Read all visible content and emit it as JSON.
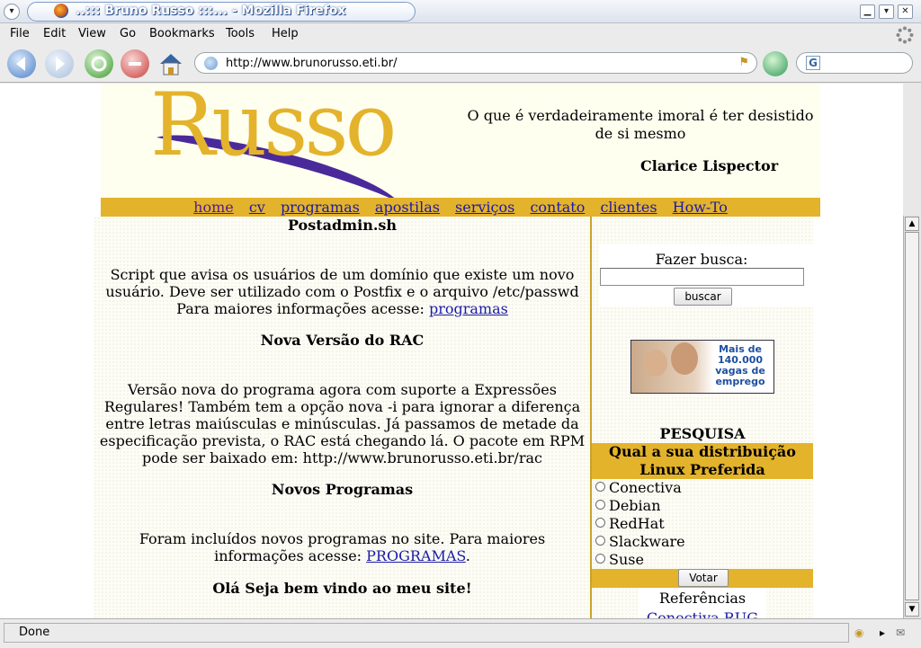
{
  "window": {
    "title": "..::: Bruno Russo :::... - Mozilla Firefox"
  },
  "menubar": {
    "items": [
      "File",
      "Edit",
      "View",
      "Go",
      "Bookmarks",
      "Tools",
      "Help"
    ]
  },
  "toolbar": {
    "url": "http://www.brunorusso.eti.br/",
    "search_engine_glyph": "G"
  },
  "status": {
    "text": "Done"
  },
  "page": {
    "logo_text": "Russo",
    "quote": "O que é verdadeiramente imoral é ter desistido de si mesmo",
    "quote_author": "Clarice Lispector",
    "nav": [
      "home",
      "cv",
      "programas",
      "apostilas",
      "serviços",
      "contato",
      "clientes",
      "How-To"
    ],
    "news": [
      {
        "title": "Postadmin.sh",
        "body": "Script que avisa os usuários de um domínio que existe um novo usuário. Deve ser utilizado com o Postfix e o arquivo /etc/passwd Para maiores informações acesse:",
        "link": "programas"
      },
      {
        "title": "Nova Versão do RAC",
        "body": "Versão nova do programa agora com suporte a Expressões Regulares! Também tem a opção nova -i para ignorar a diferença entre letras maiúsculas e minúsculas. Já passamos de metade da especificação prevista, o RAC está chegando lá. O pacote em RPM pode ser baixado em: http://www.brunorusso.eti.br/rac"
      },
      {
        "title": "Novos Programas",
        "body": "Foram incluídos novos programas no site. Para maiores informações acesse:",
        "link": "PROGRAMAS",
        "suffix": "."
      }
    ],
    "welcome": "Olá Seja bem vindo ao meu site!",
    "search": {
      "label": "Fazer busca:",
      "value": "",
      "button": "buscar"
    },
    "ad": {
      "text": "Mais de 140.000 vagas de emprego"
    },
    "poll": {
      "heading": "PESQUISA",
      "question": "Qual a sua distribuição Linux Preferida",
      "options": [
        "Conectiva",
        "Debian",
        "RedHat",
        "Slackware",
        "Suse"
      ],
      "button": "Votar"
    },
    "references": {
      "label": "Referências",
      "first_link": "Conectiva RUG"
    }
  },
  "colors": {
    "gold": "#e4b32c",
    "purple": "#4a2a9a",
    "link": "#1a1aa6",
    "banner_bg": "#fffff0"
  }
}
